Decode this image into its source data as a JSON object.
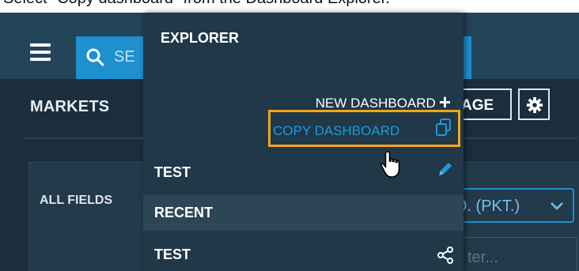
{
  "caption": "Select \"Copy dashboard\" from the Dashboard Explorer.",
  "topbar": {
    "search_text": "SE",
    "menu_icon": "hamburger-menu-icon",
    "search_icon": "search-icon"
  },
  "page": {
    "markets_label": "MARKETS",
    "manage_label": "AGE",
    "gear_icon": "gear-icon",
    "all_fields_label": "ALL FIELDS",
    "pkt_select_value": "D. (PKT.)",
    "filter_placeholder": "ter..."
  },
  "explorer": {
    "title": "EXPLORER",
    "new_dashboard_label": "NEW DASHBOARD",
    "new_dashboard_icon": "+",
    "copy_dashboard_label": "COPY DASHBOARD",
    "copy_icon": "copy-icon",
    "items": [
      {
        "label": "TEST",
        "icon": "pencil-icon"
      },
      {
        "label": "RECENT"
      },
      {
        "label": "TEST",
        "icon": "share-icon"
      }
    ]
  },
  "colors": {
    "highlight": "#f2a51a",
    "accent_blue": "#1e9bdf",
    "background": "#1a2e3d"
  }
}
